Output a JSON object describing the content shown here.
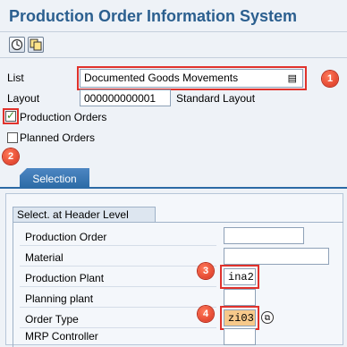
{
  "app": {
    "title": "Production Order Information System"
  },
  "toolbar": {
    "execute_icon": "execute-icon",
    "copy_icon": "copy-icon"
  },
  "form": {
    "list_label": "List",
    "list_value": "Documented Goods Movements",
    "layout_label": "Layout",
    "layout_value": "000000000001",
    "layout_text": "Standard Layout",
    "production_orders_label": "Production Orders",
    "production_orders_checked": true,
    "planned_orders_label": "Planned Orders",
    "planned_orders_checked": false
  },
  "tabs": {
    "selection_label": "Selection"
  },
  "header_level": {
    "title": "Select. at Header Level",
    "rows": [
      {
        "label": "Production Order",
        "value": ""
      },
      {
        "label": "Material",
        "value": ""
      },
      {
        "label": "Production Plant",
        "value": "ina2"
      },
      {
        "label": "Planning plant",
        "value": ""
      },
      {
        "label": "Order Type",
        "value": "zi03"
      },
      {
        "label": "MRP Controller",
        "value": ""
      }
    ]
  },
  "markers": [
    "1",
    "2",
    "3",
    "4"
  ],
  "colors": {
    "accent": "#2b5f8f",
    "highlight": "#e0322c",
    "tab": "#2b6aa5",
    "order_type_bg": "#f7c98b"
  }
}
